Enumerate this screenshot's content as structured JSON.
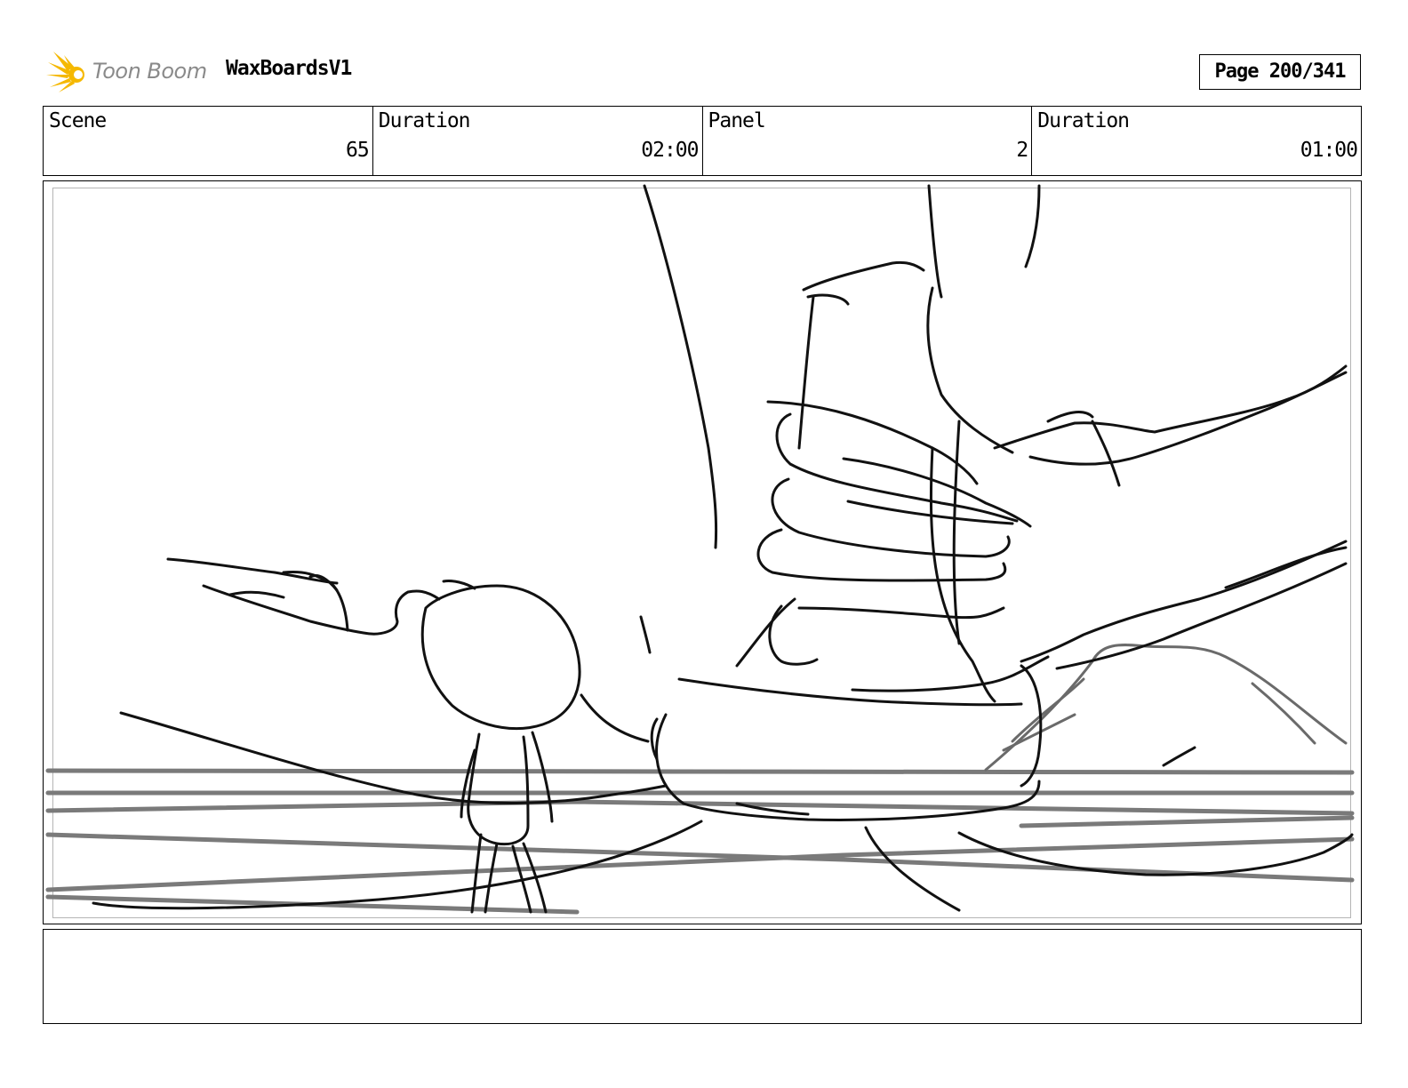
{
  "header": {
    "brand": "Toon Boom",
    "brand_icon": "sunburst-logo-icon",
    "brand_color": "#f5b800",
    "project": "WaxBoardsV1",
    "page": "Page 200/341"
  },
  "info": {
    "scene_label": "Scene",
    "scene_value": "65",
    "scene_duration_label": "Duration",
    "scene_duration_value": "02:00",
    "panel_label": "Panel",
    "panel_value": "2",
    "panel_duration_label": "Duration",
    "panel_duration_value": "01:00"
  },
  "notes": {
    "text": ""
  }
}
